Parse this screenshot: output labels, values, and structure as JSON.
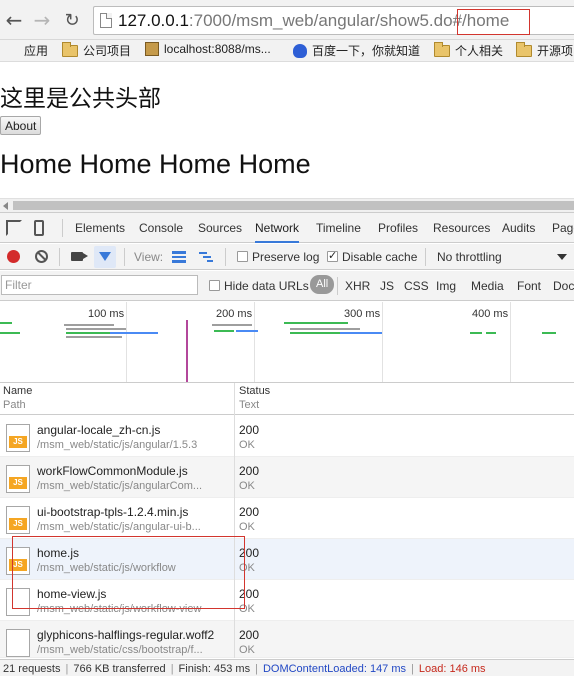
{
  "browser": {
    "url_host": "127.0.0.1",
    "url_rest": ":7000/msm_web/angular/show5.do",
    "url_hash": "#/home"
  },
  "bookmarks": [
    {
      "label": "应用",
      "icon": "apps-icon"
    },
    {
      "label": "公司项目",
      "icon": "folder-icon"
    },
    {
      "label": "localhost:8088/ms...",
      "icon": "page-icon"
    },
    {
      "label": "百度一下，你就知道",
      "icon": "baidu-paw-icon"
    },
    {
      "label": "个人相关",
      "icon": "folder-icon"
    },
    {
      "label": "开源项",
      "icon": "folder-icon"
    }
  ],
  "page": {
    "header": "这里是公共头部",
    "about_button": "About",
    "home_text": "Home Home Home Home"
  },
  "devtools": {
    "tabs": [
      "Elements",
      "Console",
      "Sources",
      "Network",
      "Timeline",
      "Profiles",
      "Resources",
      "Audits",
      "Page"
    ],
    "active_tab": "Network",
    "toolbar": {
      "view_label": "View:",
      "preserve_log": "Preserve log",
      "disable_cache": "Disable cache",
      "throttling": "No throttling"
    },
    "filter": {
      "placeholder": "Filter",
      "hide_data_urls": "Hide data URLs",
      "all": "All",
      "types": [
        "XHR",
        "JS",
        "CSS",
        "Img",
        "Media",
        "Font",
        "Doc"
      ]
    },
    "overview_labels": [
      "100 ms",
      "200 ms",
      "300 ms",
      "400 ms"
    ],
    "columns": {
      "name": "Name",
      "path": "Path",
      "status": "Status",
      "text": "Text"
    },
    "rows": [
      {
        "name": "angular-locale_zh-cn.js",
        "path": "/msm_web/static/js/angular/1.5.3",
        "status": "200",
        "text": "OK",
        "icon": "js-file-icon"
      },
      {
        "name": "workFlowCommonModule.js",
        "path": "/msm_web/static/js/angularCom...",
        "status": "200",
        "text": "OK",
        "icon": "js-file-icon"
      },
      {
        "name": "ui-bootstrap-tpls-1.2.4.min.js",
        "path": "/msm_web/static/js/angular-ui-b...",
        "status": "200",
        "text": "OK",
        "icon": "js-file-icon"
      },
      {
        "name": "home.js",
        "path": "/msm_web/static/js/workflow",
        "status": "200",
        "text": "OK",
        "icon": "js-file-icon"
      },
      {
        "name": "home-view.js",
        "path": "/msm_web/static/js/workflow-view",
        "status": "200",
        "text": "OK",
        "icon": "file-icon"
      },
      {
        "name": "glyphicons-halflings-regular.woff2",
        "path": "/msm_web/static/css/bootstrap/f...",
        "status": "200",
        "text": "OK",
        "icon": "file-icon"
      }
    ],
    "summary": {
      "requests": "21 requests",
      "transferred": "766 KB transferred",
      "finish": "Finish: 453 ms",
      "dcl": "DOMContentLoaded: 147 ms",
      "load": "Load: 146 ms"
    }
  },
  "colors": {
    "accent": "#3879d9",
    "highlight_box": "#d2352e",
    "load_line": "#b3479b"
  }
}
